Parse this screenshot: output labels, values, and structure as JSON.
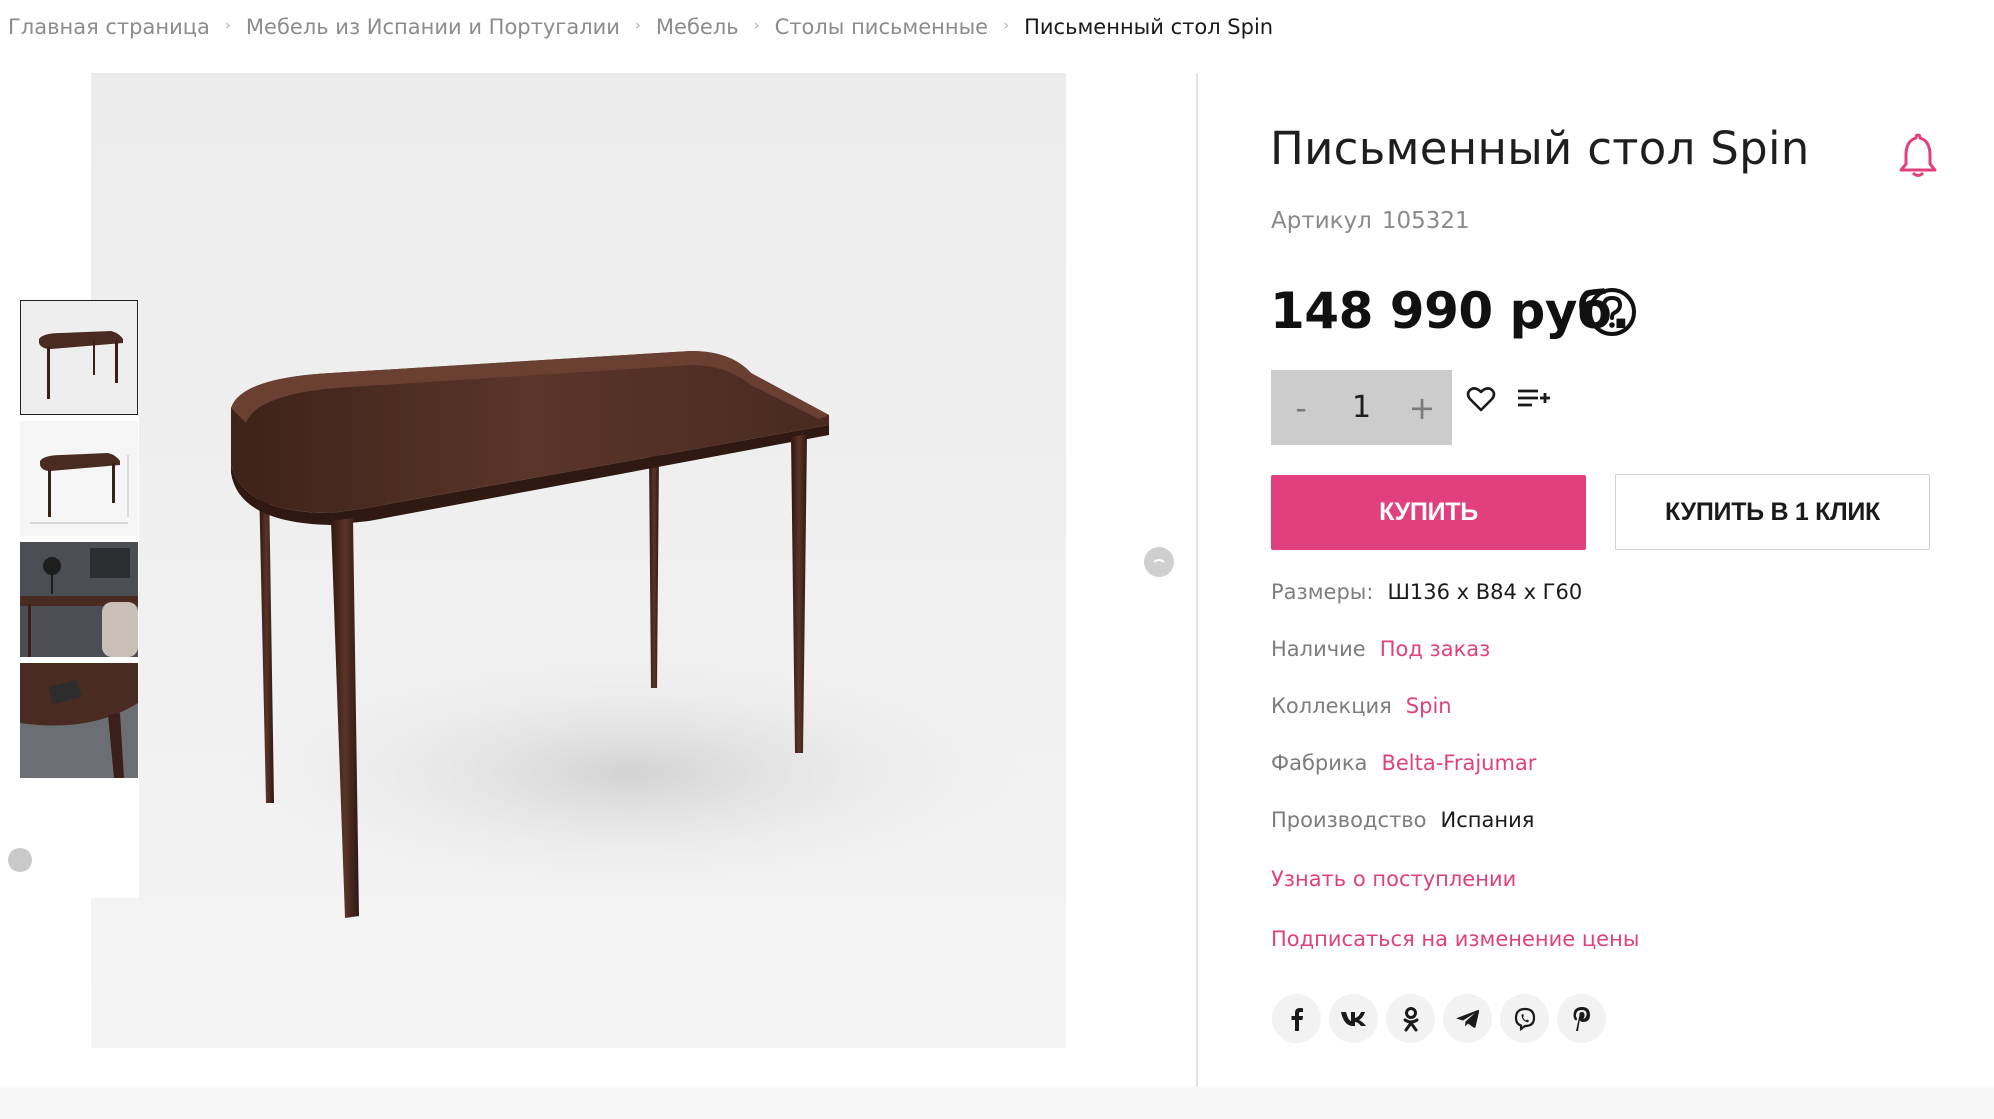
{
  "breadcrumb": {
    "items": [
      "Главная страница",
      "Мебель из Испании и Португалии",
      "Мебель",
      "Столы письменные"
    ],
    "current": "Письменный стол Spin",
    "separator": "›"
  },
  "product": {
    "title": "Письменный стол Spin",
    "sku_label": "Артикул",
    "sku": "105321",
    "price": "148 990 руб.",
    "quantity": "1",
    "qty_minus": "-",
    "qty_plus": "+",
    "buy_label": "КУПИТЬ",
    "one_click_label": "КУПИТЬ В 1 КЛИК"
  },
  "properties": {
    "size": {
      "label": "Размеры:",
      "value": "Ш136 x В84 x Г60"
    },
    "availability": {
      "label": "Наличие",
      "value": "Под заказ"
    },
    "collection": {
      "label": "Коллекция",
      "value": "Spin"
    },
    "factory": {
      "label": "Фабрика",
      "value": "Belta-Frajumar"
    },
    "origin": {
      "label": "Производство",
      "value": "Испания"
    }
  },
  "links": {
    "notify_arrival": "Узнать о поступлении",
    "price_subscribe": "Подписаться на изменение цены"
  },
  "share": {
    "facebook": "f",
    "vk": "vk",
    "ok": "ok",
    "telegram": "telegram",
    "viber": "viber",
    "pinterest": "P"
  },
  "colors": {
    "accent": "#e23f7f",
    "wood": "#4a2b22",
    "qty_bg": "#cccccc"
  },
  "icons": {
    "bell": "bell-icon",
    "help": "question-circle-icon",
    "wishlist": "heart-icon",
    "compare": "compare-list-icon"
  }
}
